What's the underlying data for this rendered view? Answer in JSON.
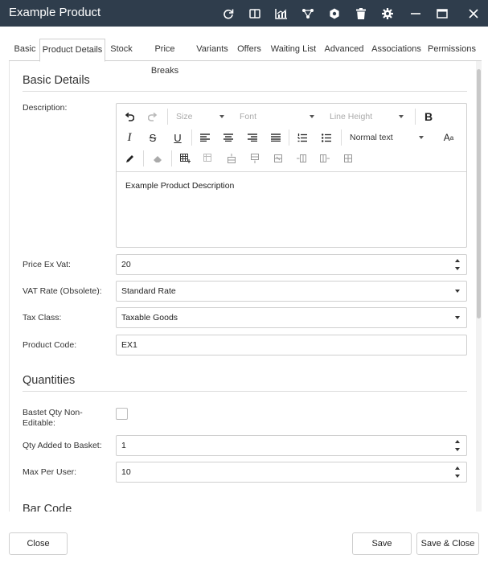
{
  "window": {
    "title": "Example Product",
    "controls": [
      "refresh-icon",
      "book-icon",
      "chart-icon",
      "network-icon",
      "hexagon-gear-icon",
      "trash-icon",
      "settings-icon",
      "minimize-icon",
      "maximize-icon",
      "close-icon"
    ]
  },
  "tabs": [
    {
      "label": "Basic"
    },
    {
      "label": "Product Details",
      "active": true
    },
    {
      "label": "Stock"
    },
    {
      "label": "Price Breaks"
    },
    {
      "label": "Variants"
    },
    {
      "label": "Offers"
    },
    {
      "label": "Waiting List"
    },
    {
      "label": "Advanced"
    },
    {
      "label": "Associations"
    },
    {
      "label": "Permissions"
    }
  ],
  "basic_details": {
    "heading": "Basic Details",
    "description_label": "Description:",
    "editor": {
      "size_placeholder": "Size",
      "font_placeholder": "Font",
      "line_height_placeholder": "Line Height",
      "paragraph_style": "Normal text",
      "content": "Example Product Description"
    },
    "price_label": "Price Ex Vat:",
    "price_value": "20",
    "vat_label": "VAT Rate (Obsolete):",
    "vat_value": "Standard Rate",
    "tax_label": "Tax Class:",
    "tax_value": "Taxable Goods",
    "code_label": "Product Code:",
    "code_value": "EX1"
  },
  "quantities": {
    "heading": "Quantities",
    "basket_label_line1": "Bastet Qty Non-",
    "basket_label_line2": "Editable:",
    "basket_checked": false,
    "qty_added_label": "Qty Added to Basket:",
    "qty_added_value": "1",
    "max_label": "Max Per User:",
    "max_value": "10"
  },
  "bar_code": {
    "heading": "Bar Code"
  },
  "footer": {
    "close_label": "Close",
    "save_label": "Save",
    "save_close_label": "Save & Close"
  },
  "colors": {
    "titlebar": "#2f3d4c",
    "active_tab_border": "#cfcfcf"
  }
}
